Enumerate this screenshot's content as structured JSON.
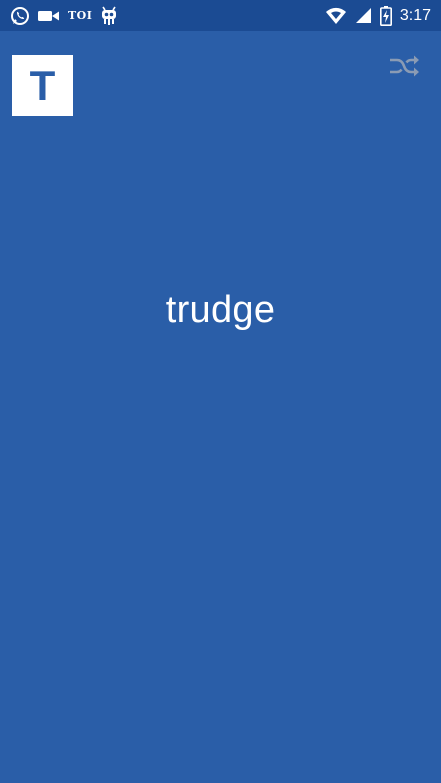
{
  "status_bar": {
    "left_icons": [
      "whatsapp-icon",
      "video-camera-icon",
      "toi-icon",
      "cyanogen-mascot-icon"
    ],
    "toi_label": "TOI",
    "right_icons": [
      "wifi-icon",
      "cell-signal-icon",
      "battery-charging-icon"
    ],
    "time": "3:17"
  },
  "app": {
    "logo_letter": "T",
    "shuffle_icon": "shuffle-icon",
    "word": "trudge"
  },
  "colors": {
    "background": "#2a5ea8",
    "status_bar": "#1b4b93",
    "logo_tile": "#ffffff",
    "shuffle_icon": "#8a9bb4",
    "text": "#ffffff"
  }
}
